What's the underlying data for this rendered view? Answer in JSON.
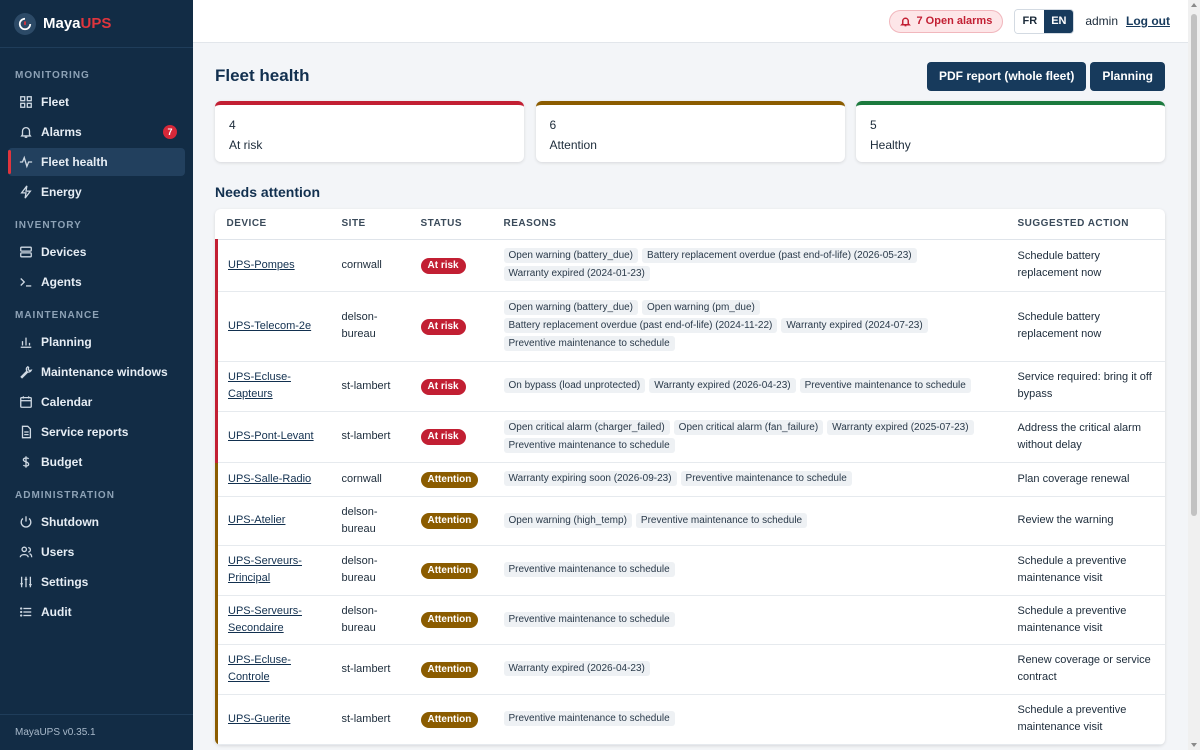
{
  "app": {
    "brand_prefix": "Maya",
    "brand_accent": "UPS",
    "version": "MayaUPS v0.35.1"
  },
  "sidebar": {
    "sections": [
      {
        "title": "MONITORING",
        "items": [
          {
            "label": "Fleet",
            "icon": "grid-icon"
          },
          {
            "label": "Alarms",
            "icon": "bell-icon",
            "badge": "7"
          },
          {
            "label": "Fleet health",
            "icon": "pulse-icon",
            "active": true
          },
          {
            "label": "Energy",
            "icon": "bolt-icon"
          }
        ]
      },
      {
        "title": "INVENTORY",
        "items": [
          {
            "label": "Devices",
            "icon": "server-icon"
          },
          {
            "label": "Agents",
            "icon": "terminal-icon"
          }
        ]
      },
      {
        "title": "MAINTENANCE",
        "items": [
          {
            "label": "Planning",
            "icon": "bar-chart-icon"
          },
          {
            "label": "Maintenance windows",
            "icon": "wrench-icon"
          },
          {
            "label": "Calendar",
            "icon": "calendar-icon"
          },
          {
            "label": "Service reports",
            "icon": "document-icon"
          },
          {
            "label": "Budget",
            "icon": "dollar-icon"
          }
        ]
      },
      {
        "title": "ADMINISTRATION",
        "items": [
          {
            "label": "Shutdown",
            "icon": "power-icon"
          },
          {
            "label": "Users",
            "icon": "users-icon"
          },
          {
            "label": "Settings",
            "icon": "sliders-icon"
          },
          {
            "label": "Audit",
            "icon": "list-icon"
          }
        ]
      }
    ]
  },
  "topbar": {
    "alarms_label": "7 Open alarms",
    "lang_fr": "FR",
    "lang_en": "EN",
    "active_lang": "EN",
    "user": "admin",
    "logout": "Log out"
  },
  "page": {
    "title": "Fleet health",
    "pdf_button": "PDF report (whole fleet)",
    "planning_button": "Planning"
  },
  "summary": {
    "at_risk": {
      "value": "4",
      "label": "At risk"
    },
    "attention": {
      "value": "6",
      "label": "Attention"
    },
    "healthy": {
      "value": "5",
      "label": "Healthy"
    }
  },
  "needs_attention": {
    "title": "Needs attention",
    "columns": {
      "device": "DEVICE",
      "site": "SITE",
      "status": "STATUS",
      "reasons": "REASONS",
      "action": "SUGGESTED ACTION"
    },
    "rows": [
      {
        "device": "UPS-Pompes",
        "site": "cornwall",
        "status": "At risk",
        "level": "risk",
        "reasons": [
          "Open warning (battery_due)",
          "Battery replacement overdue (past end-of-life) (2026-05-23)",
          "Warranty expired (2024-01-23)"
        ],
        "action": "Schedule battery replacement now"
      },
      {
        "device": "UPS-Telecom-2e",
        "site": "delson-bureau",
        "status": "At risk",
        "level": "risk",
        "reasons": [
          "Open warning (battery_due)",
          "Open warning (pm_due)",
          "Battery replacement overdue (past end-of-life) (2024-11-22)",
          "Warranty expired (2024-07-23)",
          "Preventive maintenance to schedule"
        ],
        "action": "Schedule battery replacement now"
      },
      {
        "device": "UPS-Ecluse-Capteurs",
        "site": "st-lambert",
        "status": "At risk",
        "level": "risk",
        "reasons": [
          "On bypass (load unprotected)",
          "Warranty expired (2026-04-23)",
          "Preventive maintenance to schedule"
        ],
        "action": "Service required: bring it off bypass"
      },
      {
        "device": "UPS-Pont-Levant",
        "site": "st-lambert",
        "status": "At risk",
        "level": "risk",
        "reasons": [
          "Open critical alarm (charger_failed)",
          "Open critical alarm (fan_failure)",
          "Warranty expired (2025-07-23)",
          "Preventive maintenance to schedule"
        ],
        "action": "Address the critical alarm without delay"
      },
      {
        "device": "UPS-Salle-Radio",
        "site": "cornwall",
        "status": "Attention",
        "level": "attention",
        "reasons": [
          "Warranty expiring soon (2026-09-23)",
          "Preventive maintenance to schedule"
        ],
        "action": "Plan coverage renewal"
      },
      {
        "device": "UPS-Atelier",
        "site": "delson-bureau",
        "status": "Attention",
        "level": "attention",
        "reasons": [
          "Open warning (high_temp)",
          "Preventive maintenance to schedule"
        ],
        "action": "Review the warning"
      },
      {
        "device": "UPS-Serveurs-Principal",
        "site": "delson-bureau",
        "status": "Attention",
        "level": "attention",
        "reasons": [
          "Preventive maintenance to schedule"
        ],
        "action": "Schedule a preventive maintenance visit"
      },
      {
        "device": "UPS-Serveurs-Secondaire",
        "site": "delson-bureau",
        "status": "Attention",
        "level": "attention",
        "reasons": [
          "Preventive maintenance to schedule"
        ],
        "action": "Schedule a preventive maintenance visit"
      },
      {
        "device": "UPS-Ecluse-Controle",
        "site": "st-lambert",
        "status": "Attention",
        "level": "attention",
        "reasons": [
          "Warranty expired (2026-04-23)"
        ],
        "action": "Renew coverage or service contract"
      },
      {
        "device": "UPS-Guerite",
        "site": "st-lambert",
        "status": "Attention",
        "level": "attention",
        "reasons": [
          "Preventive maintenance to schedule"
        ],
        "action": "Schedule a preventive maintenance visit"
      }
    ]
  },
  "colors": {
    "sidebar_bg": "#122c45",
    "accent_red": "#c21f33",
    "attention_brown": "#8b5c00",
    "healthy_green": "#1c7a3e",
    "primary_button": "#173a5c"
  }
}
